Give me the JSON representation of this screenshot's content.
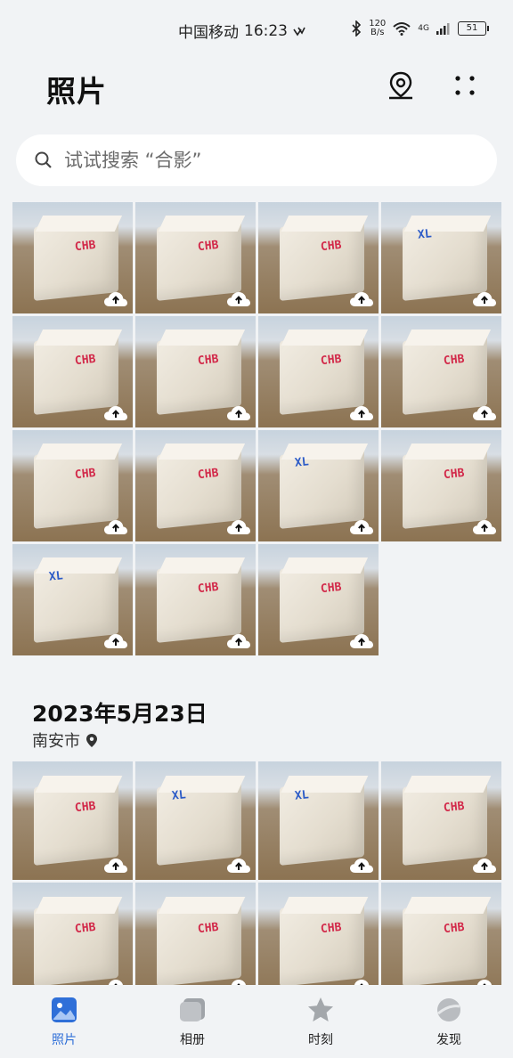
{
  "status_bar": {
    "carrier": "中国移动",
    "time": "16:23",
    "net_speed_value": "120",
    "net_speed_unit": "B/s",
    "signal_type": "4G",
    "battery": "51"
  },
  "header": {
    "title": "照片",
    "map_icon": "location-pin-icon",
    "more_icon": "more-dots-icon"
  },
  "search": {
    "placeholder": "试试搜索 “合影”"
  },
  "section1": {
    "photos": [
      {
        "mark": "CHB"
      },
      {
        "mark": "CHB"
      },
      {
        "mark": "CHB"
      },
      {
        "mark": "XL"
      },
      {
        "mark": "CHB"
      },
      {
        "mark": "CHB"
      },
      {
        "mark": "CHB"
      },
      {
        "mark": "CHB"
      },
      {
        "mark": "CHB"
      },
      {
        "mark": "CHB"
      },
      {
        "mark": "XL"
      },
      {
        "mark": "CHB"
      },
      {
        "mark": "XL"
      },
      {
        "mark": "CHB"
      },
      {
        "mark": "CHB"
      }
    ]
  },
  "section2": {
    "date": "2023年5月23日",
    "location": "南安市",
    "photos": [
      {
        "mark": "CHB"
      },
      {
        "mark": "XL"
      },
      {
        "mark": "XL"
      },
      {
        "mark": "CHB"
      },
      {
        "mark": "CHB"
      },
      {
        "mark": "CHB"
      },
      {
        "mark": "CHB"
      },
      {
        "mark": "CHB"
      }
    ]
  },
  "bottom_nav": {
    "items": [
      {
        "label": "照片",
        "icon": "photos-icon",
        "active": true
      },
      {
        "label": "相册",
        "icon": "albums-icon",
        "active": false
      },
      {
        "label": "时刻",
        "icon": "star-icon",
        "active": false
      },
      {
        "label": "发现",
        "icon": "discover-icon",
        "active": false
      }
    ]
  },
  "colors": {
    "background": "#f1f3f5",
    "active_tab": "#2f6fd8",
    "mark_red": "#d22a4a",
    "mark_blue": "#2c5bc7"
  }
}
